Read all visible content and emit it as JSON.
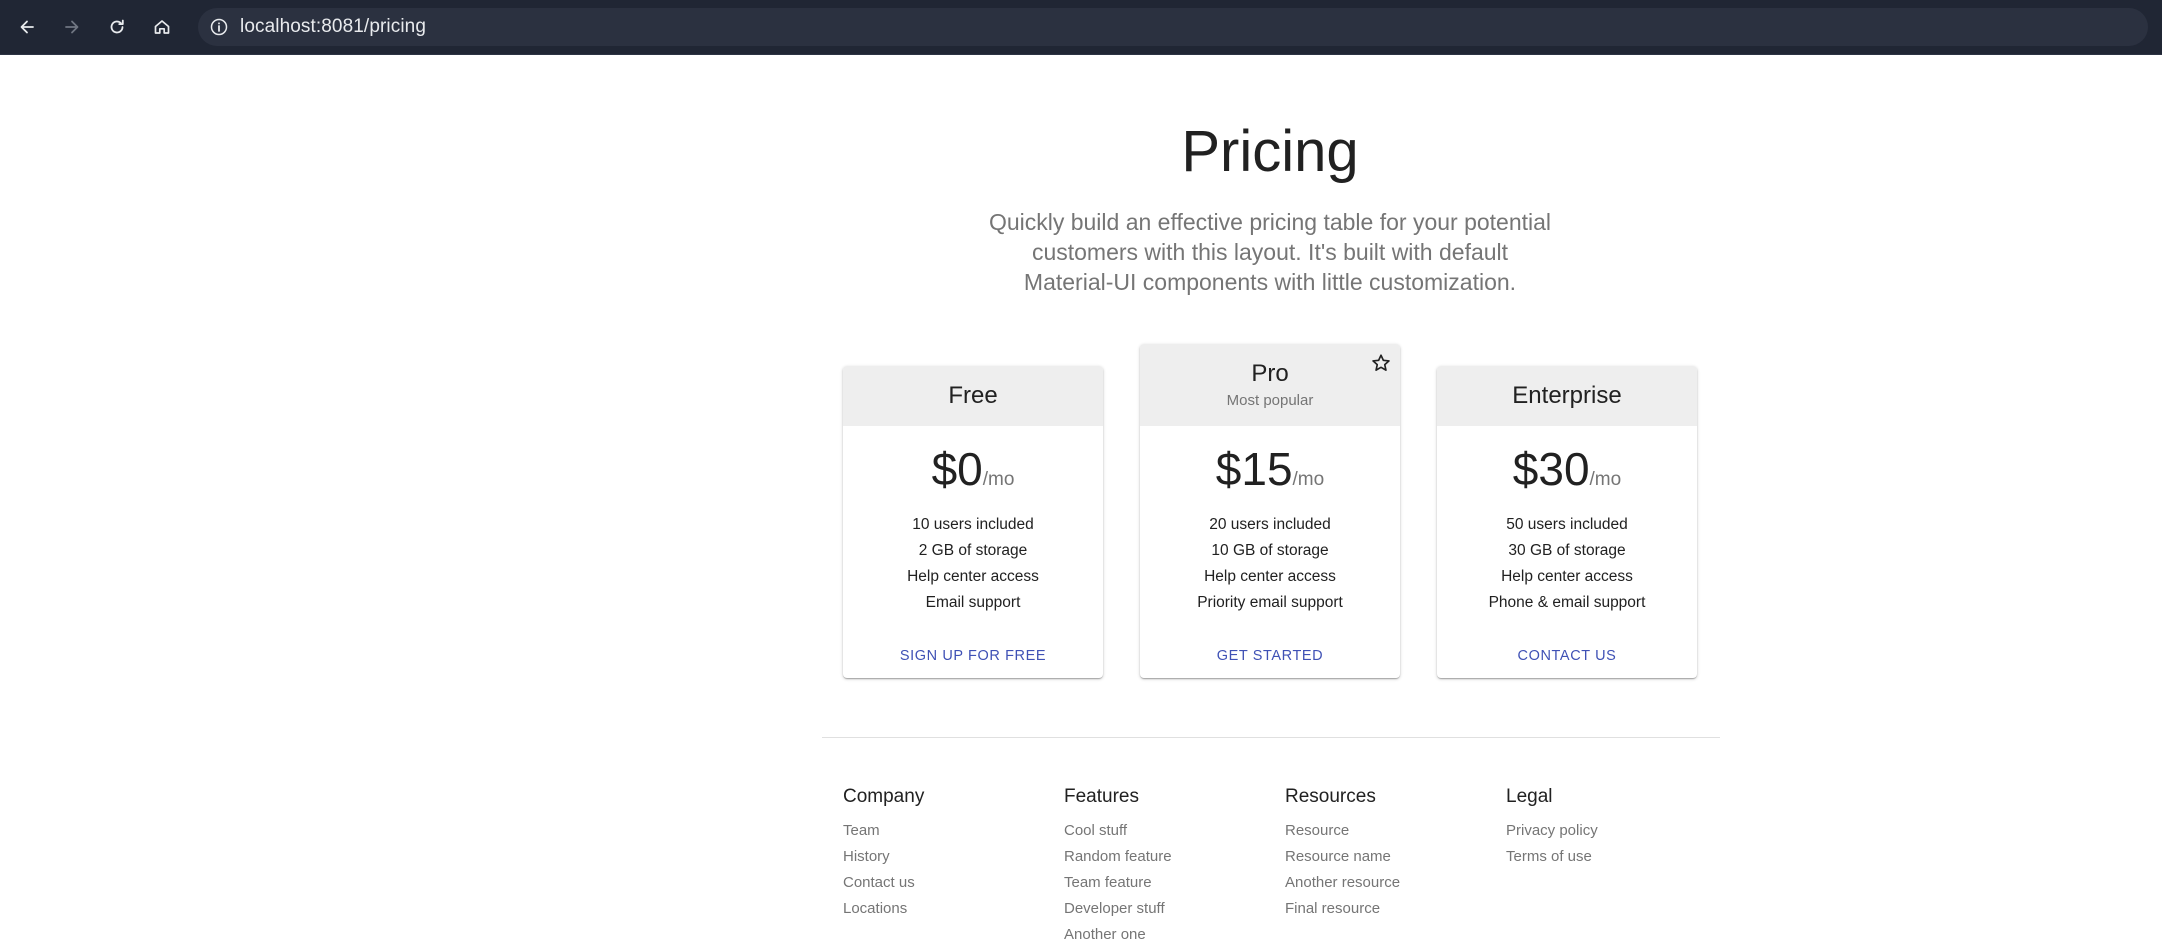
{
  "browser": {
    "url": "localhost:8081/pricing"
  },
  "hero": {
    "title": "Pricing",
    "subtitle": "Quickly build an effective pricing table for your potential customers with this layout. It's built with default Material-UI components with little customization."
  },
  "tiers": [
    {
      "title": "Free",
      "subtitle": "",
      "price": "$0",
      "per": "/mo",
      "features": [
        "10 users included",
        "2 GB of storage",
        "Help center access",
        "Email support"
      ],
      "button": "SIGN UP FOR FREE"
    },
    {
      "title": "Pro",
      "subtitle": "Most popular",
      "price": "$15",
      "per": "/mo",
      "features": [
        "20 users included",
        "10 GB of storage",
        "Help center access",
        "Priority email support"
      ],
      "button": "GET STARTED",
      "icon": "star-icon"
    },
    {
      "title": "Enterprise",
      "subtitle": "",
      "price": "$30",
      "per": "/mo",
      "features": [
        "50 users included",
        "30 GB of storage",
        "Help center access",
        "Phone & email support"
      ],
      "button": "CONTACT US"
    }
  ],
  "footer": [
    {
      "title": "Company",
      "items": [
        "Team",
        "History",
        "Contact us",
        "Locations"
      ]
    },
    {
      "title": "Features",
      "items": [
        "Cool stuff",
        "Random feature",
        "Team feature",
        "Developer stuff",
        "Another one"
      ]
    },
    {
      "title": "Resources",
      "items": [
        "Resource",
        "Resource name",
        "Another resource",
        "Final resource"
      ]
    },
    {
      "title": "Legal",
      "items": [
        "Privacy policy",
        "Terms of use"
      ]
    }
  ],
  "colors": {
    "chrome": "#202634",
    "card_header": "#eeeeee",
    "action": "#3f51b5",
    "muted_text": "#757575"
  }
}
